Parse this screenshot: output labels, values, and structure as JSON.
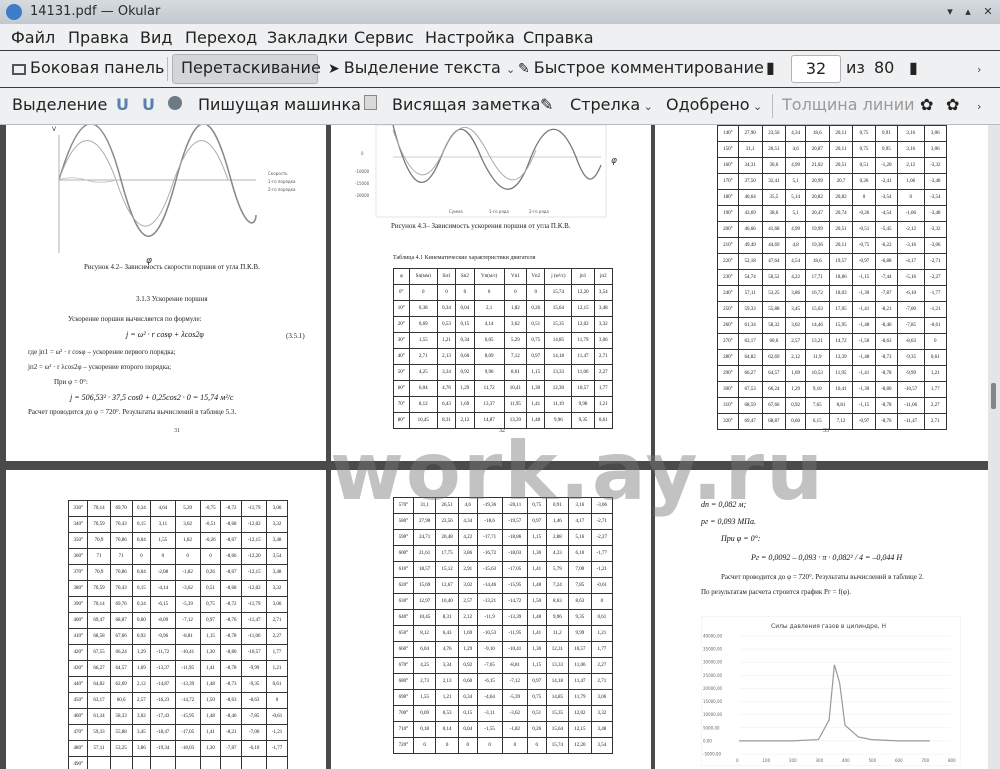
{
  "window": {
    "title": "14131.pdf — Okular"
  },
  "menu": [
    "Файл",
    "Правка",
    "Вид",
    "Переход",
    "Закладки",
    "Сервис",
    "Настройка",
    "Справка"
  ],
  "toolbar1": {
    "sidebar": "Боковая панель",
    "drag": "Перетаскивание",
    "text_select": "Выделение текста",
    "quick_comment": "Быстрое комментирование",
    "page_current": "32",
    "page_of": "из",
    "page_total": "80"
  },
  "toolbar2": {
    "selection": "Выделение",
    "typewriter": "Пишущая машинка",
    "sticky_note": "Висящая заметка",
    "arrow": "Стрелка",
    "approved": "Одобрено",
    "line_width": "Толщина линии"
  },
  "page31": {
    "fig_caption": "Рисунок 4.2– Зависимость скорости поршня от угла П.К.В.",
    "section": "3.1.3 Ускорение поршня",
    "intro": "Ускорение поршня вычисляется по формуле:",
    "formula_main": "j = ω² · r cosφ + λcos2φ",
    "formula_no": "(3.5.1)",
    "def1": "где jп1 = ω² · r cosφ – ускорение первого порядка;",
    "def2": "jп2 = ω² · r λcos2φ – ускорение второго порядка;",
    "at": "При φ = 0°:",
    "calc": "j = 506,53² · 37,5 cos0 + 0,25cos2 · 0 = 15,74 м²/с",
    "note": "Расчет проводится до φ = 720°. Результаты вычислений в таблице 5.3.",
    "page": "31",
    "legend": [
      "Скорость",
      "1-го порядка",
      "2-го порядка"
    ],
    "ylabel": "V",
    "xlabel": "φ"
  },
  "page32": {
    "fig_caption": "Рисунок 4.3– Зависимость ускорения поршня от угла П.К.В.",
    "table_title": "Таблица 4.1  Кинематические характеристики двигателя",
    "headers": [
      "φ",
      "Sп(мм)",
      "Sп1",
      "Sп2",
      "Vп(м/с)",
      "Vп1",
      "Vп2",
      "j (м²/с)",
      "jп1",
      "jп2"
    ],
    "rows": [
      [
        "0°",
        "0",
        "0",
        "0",
        "0",
        "0",
        "0",
        "15,74",
        "12,20",
        "3,54"
      ],
      [
        "10°",
        "0,38",
        "0,34",
        "0,04",
        "2,1",
        "1,82",
        "0,26",
        "15,64",
        "12,15",
        "3,48"
      ],
      [
        "20°",
        "0,69",
        "0,53",
        "0,15",
        "4,14",
        "3,62",
        "0,51",
        "15,35",
        "12,02",
        "3,32"
      ],
      [
        "30°",
        "1,55",
        "1,21",
        "0,34",
        "6,05",
        "5,29",
        "0,75",
        "14,85",
        "11,79",
        "3,06"
      ],
      [
        "40°",
        "2,71",
        "2,13",
        "0,60",
        "8,09",
        "7,12",
        "0,97",
        "14,18",
        "11,47",
        "2,71"
      ],
      [
        "50°",
        "4,25",
        "3,34",
        "0,92",
        "9,96",
        "8,61",
        "1,15",
        "13,33",
        "11,06",
        "2,27"
      ],
      [
        "60°",
        "6,04",
        "4,76",
        "1,29",
        "11,72",
        "10,41",
        "1,30",
        "12,30",
        "10,57",
        "1,77"
      ],
      [
        "70°",
        "8,12",
        "6,43",
        "1,69",
        "13,37",
        "11,95",
        "1,41",
        "11,19",
        "9,98",
        "1,21"
      ],
      [
        "80°",
        "10,45",
        "8,31",
        "2,12",
        "14,87",
        "13,39",
        "1,48",
        "9,96",
        "9,35",
        "0,61"
      ]
    ],
    "page": "32",
    "legend": [
      "Сумма",
      "1-го ряда",
      "2-го ряда"
    ],
    "yticks": [
      "0",
      "-10000",
      "-15000",
      "-20000"
    ]
  },
  "page33": {
    "rows": [
      [
        "140°",
        "27,90",
        "23,56",
        "4,34",
        "18,6",
        "20,11",
        "0,75",
        "0,91",
        "3,16",
        "3,06"
      ],
      [
        "150°",
        "31,1",
        "26,51",
        "4,6",
        "20,87",
        "20,11",
        "0,75",
        "0,95",
        "3,16",
        "3,06"
      ],
      [
        "160°",
        "34,31",
        "30,6",
        "4,99",
        "21,02",
        "20,51",
        "0,51",
        "-1,20",
        "2,12",
        "-3,32"
      ],
      [
        "170°",
        "37,50",
        "32,41",
        "5,1",
        "20,99",
        "20,7",
        "0,26",
        "-2,41",
        "1,06",
        "-3,48"
      ],
      [
        "180°",
        "40,64",
        "35,5",
        "5,14",
        "20,82",
        "20,82",
        "0",
        "-3,54",
        "0",
        "-3,54"
      ],
      [
        "190°",
        "43,69",
        "38,6",
        "5,1",
        "20,47",
        "20,74",
        "-0,26",
        "-4,54",
        "-1,06",
        "-3,48"
      ],
      [
        "200°",
        "46,66",
        "41,68",
        "4,99",
        "19,99",
        "20,51",
        "-0,51",
        "-5,45",
        "-2,12",
        "-3,32"
      ],
      [
        "210°",
        "49,49",
        "44,69",
        "4,8",
        "19,36",
        "20,11",
        "-0,75",
        "-6,22",
        "-3,16",
        "-3,06"
      ],
      [
        "220°",
        "52,18",
        "47,64",
        "4,54",
        "18,6",
        "19,57",
        "-0,97",
        "-6,88",
        "-4,17",
        "-2,71"
      ],
      [
        "230°",
        "54,74",
        "50,52",
        "4,22",
        "17,71",
        "18,86",
        "-1,15",
        "-7,44",
        "-5,16",
        "-2,27"
      ],
      [
        "240°",
        "57,11",
        "53,25",
        "3,86",
        "16,72",
        "18,03",
        "-1,30",
        "-7,87",
        "-6,10",
        "-1,77"
      ],
      [
        "250°",
        "59,33",
        "55,88",
        "3,45",
        "15,63",
        "17,05",
        "-1,41",
        "-8,21",
        "-7,00",
        "-1,21"
      ],
      [
        "260°",
        "61,34",
        "58,32",
        "3,02",
        "14,46",
        "15,95",
        "-1,48",
        "-8,46",
        "-7,85",
        "-0,61"
      ],
      [
        "270°",
        "63,17",
        "60,6",
        "2,57",
        "13,21",
        "14,72",
        "-1,50",
        "-8,63",
        "-8,63",
        "0"
      ],
      [
        "280°",
        "64,82",
        "62,69",
        "2,12",
        "11,9",
        "13,39",
        "-1,48",
        "-8,73",
        "-9,35",
        "0,61"
      ],
      [
        "290°",
        "66,27",
        "64,57",
        "1,69",
        "10,53",
        "11,95",
        "-1,41",
        "-8,78",
        "-9,99",
        "1,21"
      ],
      [
        "300°",
        "67,53",
        "66,24",
        "1,29",
        "9,10",
        "10,41",
        "-1,30",
        "-8,80",
        "-10,57",
        "1,77"
      ],
      [
        "310°",
        "68,59",
        "67,66",
        "0,92",
        "7,65",
        "8,81",
        "-1,15",
        "-8,78",
        "-11,06",
        "2,27"
      ],
      [
        "320°",
        "69,47",
        "68,87",
        "0,60",
        "6,15",
        "7,12",
        "-0,97",
        "-8,76",
        "-11,47",
        "2,71"
      ]
    ],
    "page": "33"
  },
  "page34": {
    "rows": [
      [
        "330°",
        "70,14",
        "69,70",
        "0,34",
        "4,64",
        "5,39",
        "-0,75",
        "-8,72",
        "-11,79",
        "3,06"
      ],
      [
        "340°",
        "70,59",
        "70,43",
        "0,15",
        "3,11",
        "3,62",
        "-0,51",
        "-8,68",
        "-12,02",
        "3,32"
      ],
      [
        "350°",
        "70,9",
        "70,86",
        "0,04",
        "1,55",
        "1,82",
        "-0,26",
        "-8,67",
        "-12,15",
        "3,48"
      ],
      [
        "360°",
        "71",
        "71",
        "0",
        "0",
        "0",
        "0",
        "-8,66",
        "-12,20",
        "3,54"
      ],
      [
        "370°",
        "70,9",
        "70,86",
        "0,04",
        "-2,08",
        "-1,82",
        "0,26",
        "-8,67",
        "-12,15",
        "3,48"
      ],
      [
        "380°",
        "70,59",
        "70,43",
        "0,15",
        "-4,14",
        "-3,62",
        "0,51",
        "-8,68",
        "-12,02",
        "3,32"
      ],
      [
        "390°",
        "70,14",
        "69,76",
        "0,34",
        "-6,15",
        "-5,39",
        "0,75",
        "-8,72",
        "-11,79",
        "3,06"
      ],
      [
        "400°",
        "69,47",
        "68,87",
        "0,60",
        "-8,09",
        "-7,12",
        "0,97",
        "-8,76",
        "-11,47",
        "2,71"
      ],
      [
        "410°",
        "68,58",
        "67,66",
        "0,92",
        "-9,96",
        "-8,81",
        "1,15",
        "-8,78",
        "-11,06",
        "2,27"
      ],
      [
        "420°",
        "67,55",
        "66,24",
        "1,29",
        "-11,72",
        "-10,41",
        "1,30",
        "-8,80",
        "-10,57",
        "1,77"
      ],
      [
        "430°",
        "66,27",
        "64,57",
        "1,69",
        "-13,37",
        "-11,95",
        "1,41",
        "-8,78",
        "-9,99",
        "1,21"
      ],
      [
        "440°",
        "64,82",
        "62,69",
        "2,12",
        "-14,87",
        "-13,39",
        "1,48",
        "-8,73",
        "-9,35",
        "0,61"
      ],
      [
        "450°",
        "63,17",
        "60,6",
        "2,57",
        "-16,23",
        "-14,72",
        "1,50",
        "-8,63",
        "-8,63",
        "0"
      ],
      [
        "460°",
        "61,34",
        "58,33",
        "3,02",
        "-17,43",
        "-15,95",
        "1,48",
        "-8,46",
        "-7,85",
        "-0,61"
      ],
      [
        "470°",
        "59,33",
        "55,88",
        "3,45",
        "-18,47",
        "-17,05",
        "1,41",
        "-8,21",
        "-7,00",
        "-1,21"
      ],
      [
        "480°",
        "57,11",
        "53,25",
        "3,86",
        "-19,34",
        "-18,03",
        "1,30",
        "-7,87",
        "-6,10",
        "-1,77"
      ]
    ],
    "partial": "490°"
  },
  "page35": {
    "rows": [
      [
        "570°",
        "31,1",
        "26,51",
        "4,6",
        "-19,36",
        "-20,11",
        "0,75",
        "0,91",
        "3,16",
        "-3,06"
      ],
      [
        "580°",
        "27,90",
        "23,56",
        "4,34",
        "-18,6",
        "-19,57",
        "0,97",
        "1,46",
        "4,17",
        "-2,71"
      ],
      [
        "590°",
        "24,71",
        "20,48",
        "4,22",
        "-17,71",
        "-18,86",
        "1,15",
        "2,88",
        "5,16",
        "-2,27"
      ],
      [
        "600°",
        "21,61",
        "17,75",
        "3,86",
        "-16,72",
        "-18,03",
        "1,30",
        "4,33",
        "6,10",
        "-1,77"
      ],
      [
        "610°",
        "18,57",
        "15,12",
        "2,91",
        "-15,63",
        "-17,05",
        "1,41",
        "5,79",
        "7,00",
        "-1,21"
      ],
      [
        "620°",
        "15,69",
        "12,67",
        "3,02",
        "-14,46",
        "-15,95",
        "1,48",
        "7,24",
        "7,85",
        "-0,61"
      ],
      [
        "630°",
        "12,97",
        "10,40",
        "2,57",
        "-13,21",
        "-14,72",
        "1,50",
        "8,63",
        "8,63",
        "0"
      ],
      [
        "640°",
        "10,45",
        "8,31",
        "2,12",
        "-11,9",
        "-13,39",
        "1,48",
        "9,96",
        "9,35",
        "0,61"
      ],
      [
        "650°",
        "8,12",
        "6,43",
        "1,69",
        "-10,53",
        "-11,95",
        "1,41",
        "11,2",
        "9,99",
        "1,21"
      ],
      [
        "660°",
        "6,04",
        "4,76",
        "1,29",
        "-9,10",
        "-10,41",
        "1,30",
        "12,31",
        "10,57",
        "1,77"
      ],
      [
        "670°",
        "4,25",
        "3,34",
        "0,92",
        "-7,65",
        "-8,81",
        "1,15",
        "13,33",
        "11,06",
        "2,27"
      ],
      [
        "680°",
        "2,73",
        "2,13",
        "0,60",
        "-6,15",
        "-7,12",
        "0,97",
        "14,18",
        "11,47",
        "2,71"
      ],
      [
        "690°",
        "1,55",
        "1,21",
        "0,34",
        "-4,64",
        "-5,39",
        "0,75",
        "14,85",
        "11,79",
        "3,06"
      ],
      [
        "700°",
        "0,69",
        "0,53",
        "0,15",
        "-3,11",
        "-3,62",
        "0,51",
        "15,35",
        "12,02",
        "3,32"
      ],
      [
        "710°",
        "0,18",
        "0,14",
        "0,04",
        "-1,55",
        "-1,82",
        "0,26",
        "15,64",
        "12,15",
        "3,48"
      ],
      [
        "720°",
        "0",
        "0",
        "0",
        "0",
        "0",
        "0",
        "15,74",
        "12,20",
        "3,54"
      ]
    ]
  },
  "page36": {
    "l1": "dп = 0,082 м;",
    "l2": "pг = 0,093 МПа.",
    "l3": "При φ = 0°:",
    "l4": "Pг = 0,0092 – 0,093 · π · 0,082² / 4 = –0,044 Н",
    "l5": "Расчет проводится до φ = 720°. Результаты вычислений в таблице 2.",
    "l6": "По результатам расчета строится график Pг = f(φ).",
    "chart_title": "Силы давления газов в цилиндре, Н",
    "yticks": [
      "40000,00",
      "35000,00",
      "30000,00",
      "25000,00",
      "20000,00",
      "15000,00",
      "10000,00",
      "5000,00",
      "0,00",
      "-5000,00"
    ],
    "xticks": [
      "0",
      "100",
      "200",
      "300",
      "400",
      "500",
      "600",
      "700",
      "800"
    ]
  },
  "watermark": "work.ay.ru",
  "chart_data": [
    {
      "type": "line",
      "x": [
        0,
        90,
        180,
        270,
        360,
        450,
        540,
        630,
        720
      ],
      "series": [
        {
          "name": "Сумма",
          "values": [
            0,
            18,
            0,
            -18,
            0,
            18,
            0,
            -18,
            0
          ]
        }
      ]
    },
    {
      "type": "line",
      "title": "Силы давления газов в цилиндре, Н",
      "x": [
        0,
        100,
        200,
        300,
        340,
        360,
        380,
        400,
        450,
        500,
        600,
        720
      ],
      "series": [
        {
          "name": "",
          "values": [
            0,
            0,
            0,
            500,
            8000,
            29000,
            22000,
            6000,
            1500,
            500,
            0,
            0
          ]
        }
      ],
      "ylim": [
        -5000,
        40000
      ]
    }
  ]
}
